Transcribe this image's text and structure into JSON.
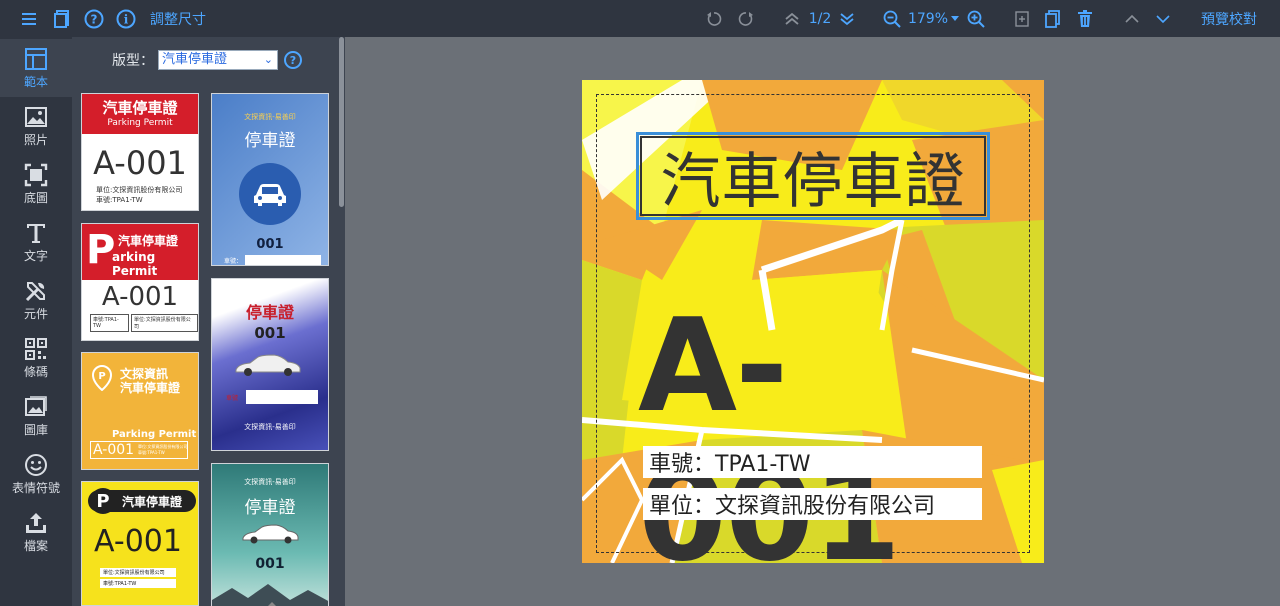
{
  "toolbar": {
    "resize_label": "調整尺寸",
    "page_indicator": "1/2",
    "zoom_level": "179%",
    "preview_label": "預覽校對"
  },
  "nav": {
    "items": [
      {
        "label": "範本",
        "icon": "layout-icon"
      },
      {
        "label": "照片",
        "icon": "image-icon"
      },
      {
        "label": "底圖",
        "icon": "background-icon"
      },
      {
        "label": "文字",
        "icon": "text-icon"
      },
      {
        "label": "元件",
        "icon": "tools-icon"
      },
      {
        "label": "條碼",
        "icon": "qrcode-icon"
      },
      {
        "label": "圖庫",
        "icon": "gallery-icon"
      },
      {
        "label": "表情符號",
        "icon": "smiley-icon"
      },
      {
        "label": "檔案",
        "icon": "upload-icon"
      }
    ]
  },
  "panel": {
    "type_label": "版型：",
    "type_value": "汽車停車證",
    "help": "?"
  },
  "thumbnails": {
    "t1": {
      "title": "汽車停車證",
      "sub": "Parking Permit",
      "num": "A-001",
      "l1": "單位:文探資訊股份有限公司",
      "l2": "車號:TPA1-TW"
    },
    "t2": {
      "top": "文探資訊-易善印",
      "title": "停車證",
      "num": "001",
      "label": "車號："
    },
    "t3": {
      "title": "汽車停車證",
      "sub": "arking Permit",
      "p": "P",
      "num": "A-001",
      "l1": "車號:TPA1-TW",
      "l2": "單位:文探資訊股份有限公司"
    },
    "t4": {
      "title": "停車證",
      "num": "001",
      "label": "車號",
      "foot": "文探資訊-易善印"
    },
    "t5": {
      "l1": "文探資訊",
      "l2": "汽車停車證",
      "sub": "Parking Permit",
      "num": "A-001",
      "s1": "單位:文探資訊股份有限公司",
      "s2": "車號:TPA1-TW"
    },
    "t6": {
      "top": "文探資訊-易善印",
      "title": "停車證",
      "num": "001"
    },
    "t7": {
      "p": "P",
      "title": "汽車停車證",
      "num": "A-001",
      "l1": "單位:文探資訊股份有限公司",
      "l2": "車號:TPA1-TW"
    }
  },
  "document": {
    "title": "汽車停車證",
    "number": "A-001",
    "plate": "車號：TPA1-TW",
    "org": "單位：文探資訊股份有限公司"
  },
  "colors": {
    "accent": "#4da6ff",
    "toolbar_bg": "#2f3540",
    "panel_bg": "#3d4450",
    "canvas_bg": "#6b7077",
    "doc_yellow": "#f8e81a",
    "doc_orange": "#f2a93b"
  }
}
